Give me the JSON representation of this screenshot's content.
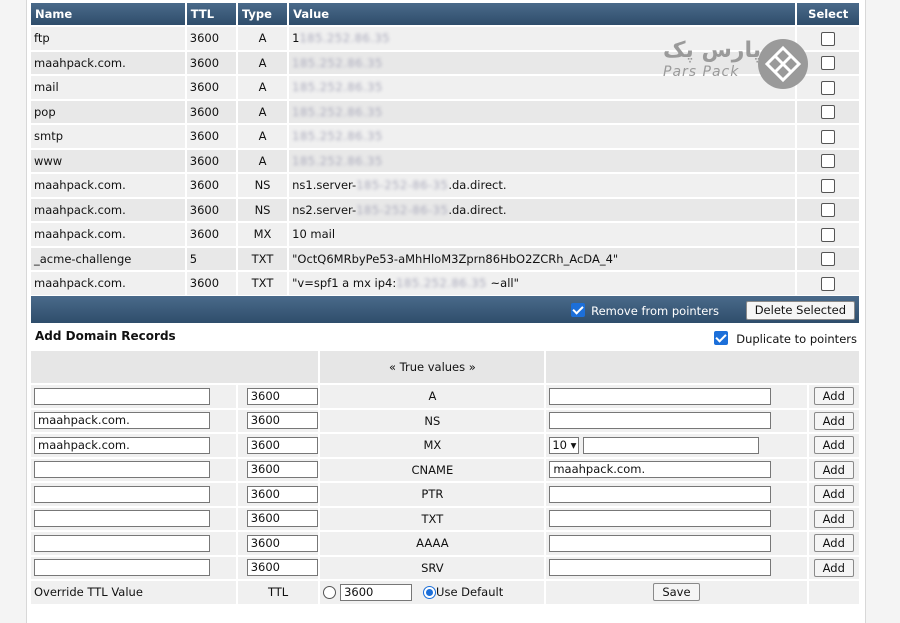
{
  "records_table": {
    "headers": [
      "Name",
      "TTL",
      "Type",
      "Value",
      "Select"
    ],
    "rows": [
      {
        "name": "ftp",
        "ttl": "3600",
        "type": "A",
        "value_prefix": "1",
        "value_blur": "185.252.86.35",
        "value_suffix": ""
      },
      {
        "name": "maahpack.com.",
        "ttl": "3600",
        "type": "A",
        "value_prefix": "",
        "value_blur": "185.252.86.35",
        "value_suffix": ""
      },
      {
        "name": "mail",
        "ttl": "3600",
        "type": "A",
        "value_prefix": "",
        "value_blur": "185.252.86.35",
        "value_suffix": ""
      },
      {
        "name": "pop",
        "ttl": "3600",
        "type": "A",
        "value_prefix": "",
        "value_blur": "185.252.86.35",
        "value_suffix": ""
      },
      {
        "name": "smtp",
        "ttl": "3600",
        "type": "A",
        "value_prefix": "",
        "value_blur": "185.252.86.35",
        "value_suffix": ""
      },
      {
        "name": "www",
        "ttl": "3600",
        "type": "A",
        "value_prefix": "",
        "value_blur": "185.252.86.35",
        "value_suffix": ""
      },
      {
        "name": "maahpack.com.",
        "ttl": "3600",
        "type": "NS",
        "value_prefix": "ns1.server-",
        "value_blur": "185-252-86-35",
        "value_suffix": ".da.direct."
      },
      {
        "name": "maahpack.com.",
        "ttl": "3600",
        "type": "NS",
        "value_prefix": "ns2.server-",
        "value_blur": "185-252-86-35",
        "value_suffix": ".da.direct."
      },
      {
        "name": "maahpack.com.",
        "ttl": "3600",
        "type": "MX",
        "value_prefix": "10 mail",
        "value_blur": "",
        "value_suffix": ""
      },
      {
        "name": "_acme-challenge",
        "ttl": "5",
        "type": "TXT",
        "value_prefix": "\"OctQ6MRbyPe53-aMhHloM3Zprn86HbO2ZCRh_AcDA_4\"",
        "value_blur": "",
        "value_suffix": ""
      },
      {
        "name": "maahpack.com.",
        "ttl": "3600",
        "type": "TXT",
        "value_prefix": "\"v=spf1 a mx ip4:",
        "value_blur": "185.252.86.35",
        "value_suffix": " ~all\""
      }
    ]
  },
  "toolbar": {
    "remove_from_pointers_label": "Remove from pointers",
    "delete_selected_label": "Delete Selected"
  },
  "add_section": {
    "title": "Add Domain Records",
    "duplicate_label": "Duplicate to pointers",
    "true_values_label": "« True values »",
    "add_label": "Add",
    "rows": [
      {
        "name": "",
        "ttl": "3600",
        "type": "A",
        "value": ""
      },
      {
        "name": "maahpack.com.",
        "ttl": "3600",
        "type": "NS",
        "value": ""
      },
      {
        "name": "maahpack.com.",
        "ttl": "3600",
        "type": "MX",
        "priority": "10",
        "value": ""
      },
      {
        "name": "",
        "ttl": "3600",
        "type": "CNAME",
        "value": "maahpack.com."
      },
      {
        "name": "",
        "ttl": "3600",
        "type": "PTR",
        "value": ""
      },
      {
        "name": "",
        "ttl": "3600",
        "type": "TXT",
        "value": ""
      },
      {
        "name": "",
        "ttl": "3600",
        "type": "AAAA",
        "value": ""
      },
      {
        "name": "",
        "ttl": "3600",
        "type": "SRV",
        "value": ""
      }
    ],
    "override": {
      "label": "Override TTL Value",
      "ttl_label": "TTL",
      "ttl_value": "3600",
      "use_default_label": "Use Default",
      "save_label": "Save"
    }
  },
  "logo": {
    "fa_text": "پارس پک",
    "en_text": "Pars Pack",
    "icon": "diamond-grid-icon",
    "color": "#9a9a9a"
  },
  "colors": {
    "header_bg": "#3d5d7c",
    "checkbox_on": "#1c6fd9"
  }
}
